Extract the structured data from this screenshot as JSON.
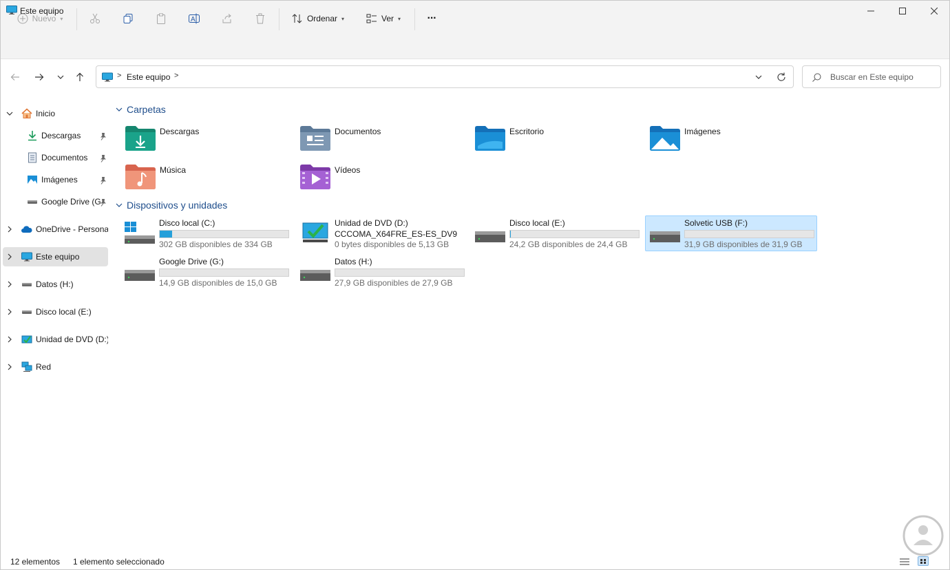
{
  "window": {
    "title": "Este equipo"
  },
  "toolbar": {
    "new_label": "Nuevo",
    "sort_label": "Ordenar",
    "view_label": "Ver",
    "more_label": "···"
  },
  "address": {
    "crumbs": [
      "Este equipo"
    ],
    "separator": ">"
  },
  "search": {
    "placeholder": "Buscar en Este equipo"
  },
  "sidebar": {
    "items": [
      {
        "label": "Inicio"
      },
      {
        "label": "Descargas"
      },
      {
        "label": "Documentos"
      },
      {
        "label": "Imágenes"
      },
      {
        "label": "Google Drive (G"
      },
      {
        "label": "OneDrive - Personal"
      },
      {
        "label": "Este equipo"
      },
      {
        "label": "Datos (H:)"
      },
      {
        "label": "Disco local (E:)"
      },
      {
        "label": "Unidad de DVD (D:)"
      },
      {
        "label": "Red"
      }
    ]
  },
  "content": {
    "folders_header": "Carpetas",
    "folders": [
      {
        "name": "Descargas",
        "color": "#1aa38a"
      },
      {
        "name": "Documentos",
        "color": "#7e98b3"
      },
      {
        "name": "Escritorio",
        "color": "#1a8fd6"
      },
      {
        "name": "Imágenes",
        "color": "#1a8fd6"
      },
      {
        "name": "Música",
        "color": "#e8836a"
      },
      {
        "name": "Vídeos",
        "color": "#9a55c7"
      }
    ],
    "devices_header": "Dispositivos y unidades",
    "drives": [
      {
        "name": "Disco local (C:)",
        "info": "302 GB disponibles de 334 GB",
        "used_fraction": 0.096
      },
      {
        "name": "Unidad de DVD (D:)",
        "name2": "CCCOMA_X64FRE_ES-ES_DV9",
        "info": "0 bytes disponibles de 5,13 GB"
      },
      {
        "name": "Disco local (E:)",
        "info": "24,2 GB disponibles de 24,4 GB",
        "used_fraction": 0.008
      },
      {
        "name": "Solvetic USB (F:)",
        "info": "31,9 GB disponibles de 31,9 GB",
        "used_fraction": 0.0
      },
      {
        "name": "Google Drive (G:)",
        "info": "14,9 GB disponibles de 15,0 GB",
        "used_fraction": 0.0
      },
      {
        "name": "Datos (H:)",
        "info": "27,9 GB disponibles de 27,9 GB",
        "used_fraction": 0.0
      }
    ]
  },
  "status": {
    "count": "12 elementos",
    "selection": "1 elemento seleccionado"
  },
  "colors": {
    "accent": "#26a0da",
    "selection_bg": "#cce8ff",
    "group_header": "#1f4e8c"
  }
}
